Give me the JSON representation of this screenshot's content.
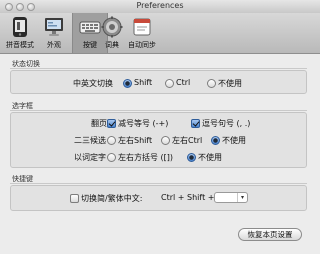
{
  "window": {
    "title": "Preferences"
  },
  "toolbar": {
    "items": [
      {
        "label": "拼音模式",
        "icon": "phone-icon"
      },
      {
        "label": "外观",
        "icon": "monitor-icon"
      },
      {
        "label": "按键",
        "icon": "keyboard-icon",
        "selected": true
      },
      {
        "label": "词典",
        "icon": "dictionary-gear-icon"
      },
      {
        "label": "自动同步",
        "icon": "sync-icon"
      }
    ]
  },
  "sections": {
    "state": {
      "title": "状态切换",
      "switch_label": "中英文切换",
      "options": [
        "Shift",
        "Ctrl",
        "不使用"
      ],
      "selected": "Shift"
    },
    "candidate": {
      "title": "选字框",
      "page_label": "翻页",
      "page_options": [
        "减号等号 (-+)",
        "逗号句号 (, .)"
      ],
      "page_checked": [
        true,
        true
      ],
      "second_third_label": "二三候选",
      "second_third_options": [
        "左右Shift",
        "左右Ctrl",
        "不使用"
      ],
      "second_third_selected": "不使用",
      "word_label": "以词定字",
      "word_options": [
        "左右方括号 ([])",
        "不使用"
      ],
      "word_selected": "不使用"
    },
    "shortcut": {
      "title": "快捷键",
      "toggle_label": "切换简/繁体中文:",
      "toggle_checked": false,
      "combo_text": "Ctrl + Shift +",
      "key_value": ""
    }
  },
  "buttons": {
    "restore": "恢复本页设置"
  },
  "colors": {
    "accent": "#4a84cf",
    "window_bg": "#ececec",
    "toolbar_selected": "#9f9f9f"
  }
}
